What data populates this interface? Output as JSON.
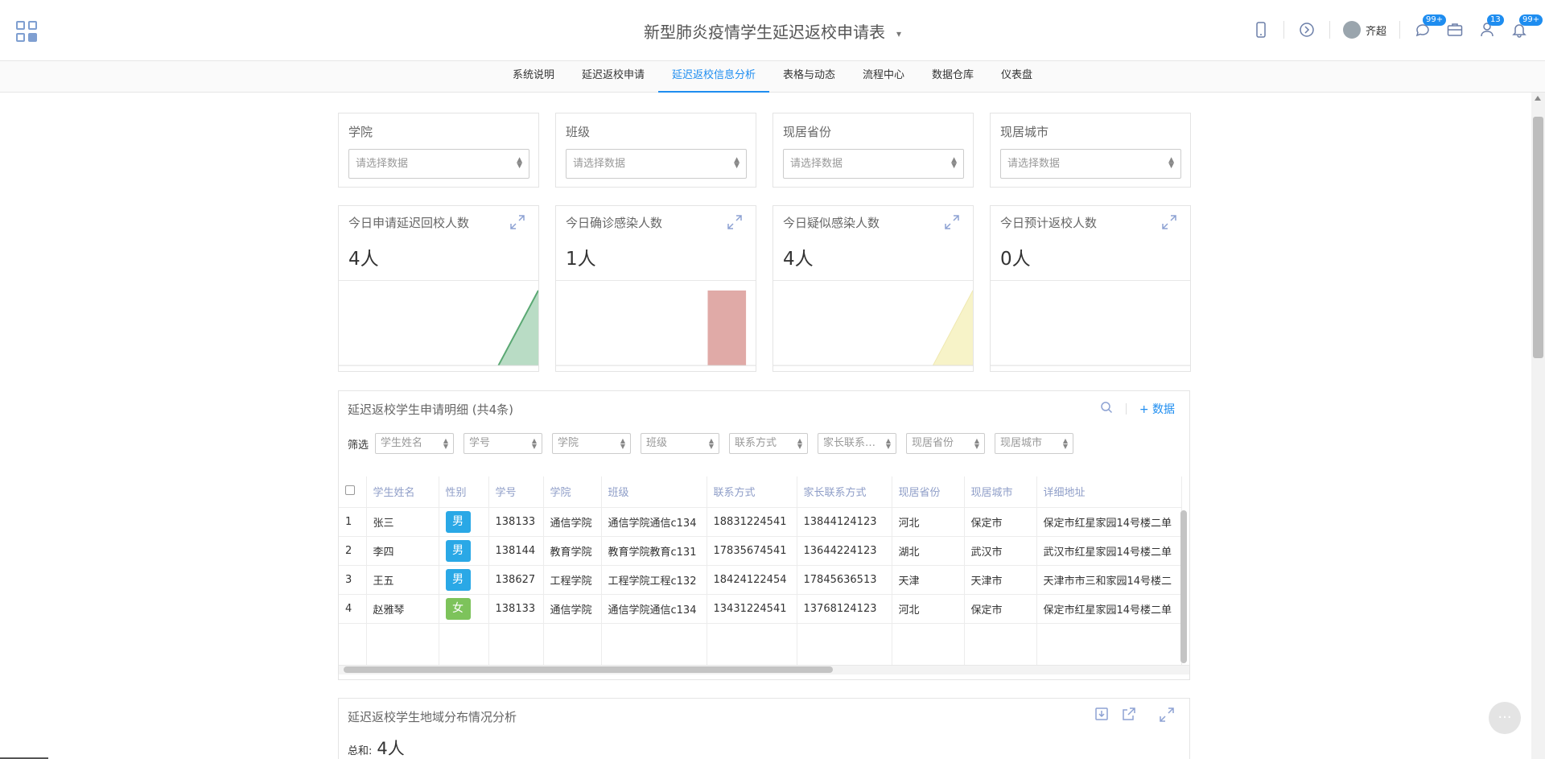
{
  "app": {
    "title": "新型肺炎疫情学生延迟返校申请表",
    "title_caret": "▾",
    "user_name": "齐超",
    "badges": {
      "chat": "99+",
      "messages": "13",
      "notifications": "99+"
    }
  },
  "nav": {
    "tabs": [
      {
        "label": "系统说明",
        "active": false
      },
      {
        "label": "延迟返校申请",
        "active": false
      },
      {
        "label": "延迟返校信息分析",
        "active": true
      },
      {
        "label": "表格与动态",
        "active": false
      },
      {
        "label": "流程中心",
        "active": false
      },
      {
        "label": "数据仓库",
        "active": false
      },
      {
        "label": "仪表盘",
        "active": false
      }
    ]
  },
  "filters": [
    {
      "label": "学院",
      "placeholder": "请选择数据"
    },
    {
      "label": "班级",
      "placeholder": "请选择数据"
    },
    {
      "label": "现居省份",
      "placeholder": "请选择数据"
    },
    {
      "label": "现居城市",
      "placeholder": "请选择数据"
    }
  ],
  "stats": [
    {
      "label": "今日申请延迟回校人数",
      "value": "4人",
      "color": "#8cc9a4"
    },
    {
      "label": "今日确诊感染人数",
      "value": "1人",
      "color": "#e0aaa7"
    },
    {
      "label": "今日疑似感染人数",
      "value": "4人",
      "color": "#f7f3c8"
    },
    {
      "label": "今日预计返校人数",
      "value": "0人",
      "color": "#dddddd"
    }
  ],
  "table": {
    "title": "延迟返校学生申请明细 (共4条)",
    "add_label": "+ 数据",
    "filter_label": "筛选",
    "filter_fields": [
      "学生姓名",
      "学号",
      "学院",
      "班级",
      "联系方式",
      "家长联系…",
      "现居省份",
      "现居城市"
    ],
    "columns": [
      "学生姓名",
      "性别",
      "学号",
      "学院",
      "班级",
      "联系方式",
      "家长联系方式",
      "现居省份",
      "现居城市",
      "详细地址"
    ],
    "rows": [
      {
        "idx": "1",
        "name": "张三",
        "gender": "男",
        "sid": "138133",
        "college": "通信学院",
        "class": "通信学院通信c134",
        "phone": "18831224541",
        "parent_phone": "13844124123",
        "province": "河北",
        "city": "保定市",
        "address": "保定市红星家园14号楼二单"
      },
      {
        "idx": "2",
        "name": "李四",
        "gender": "男",
        "sid": "138144",
        "college": "教育学院",
        "class": "教育学院教育c131",
        "phone": "17835674541",
        "parent_phone": "13644224123",
        "province": "湖北",
        "city": "武汉市",
        "address": "武汉市红星家园14号楼二单"
      },
      {
        "idx": "3",
        "name": "王五",
        "gender": "男",
        "sid": "138627",
        "college": "工程学院",
        "class": "工程学院工程c132",
        "phone": "18424122454",
        "parent_phone": "17845636513",
        "province": "天津",
        "city": "天津市",
        "address": "天津市市三和家园14号楼二"
      },
      {
        "idx": "4",
        "name": "赵雅琴",
        "gender": "女",
        "sid": "138133",
        "college": "通信学院",
        "class": "通信学院通信c134",
        "phone": "13431224541",
        "parent_phone": "13768124123",
        "province": "河北",
        "city": "保定市",
        "address": "保定市红星家园14号楼二单"
      }
    ]
  },
  "geo": {
    "title": "延迟返校学生地域分布情况分析",
    "sum_label": "总和:",
    "sum_value": "4人"
  },
  "icons": [
    "app-grid-icon",
    "mobile-icon",
    "compass-icon",
    "chat-icon",
    "briefcase-icon",
    "contacts-icon",
    "bell-icon",
    "expand-icon",
    "search-icon",
    "export-icon",
    "share-icon",
    "more-icon"
  ]
}
